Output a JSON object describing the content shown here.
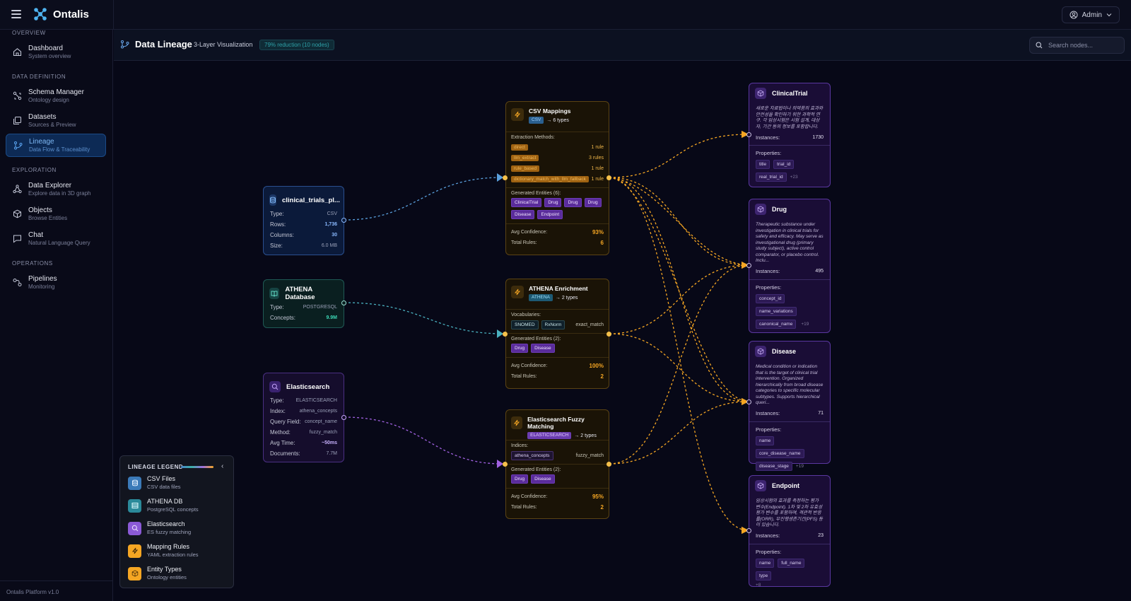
{
  "app": {
    "name": "Ontalis",
    "user_label": "Admin",
    "version": "Ontalis Platform v1.0"
  },
  "sidebar": {
    "sections": [
      {
        "title": "OVERVIEW",
        "items": [
          {
            "label": "Dashboard",
            "sub": "System overview",
            "icon": "home-icon"
          }
        ]
      },
      {
        "title": "DATA DEFINITION",
        "items": [
          {
            "label": "Schema Manager",
            "sub": "Ontology design",
            "icon": "schema-icon"
          },
          {
            "label": "Datasets",
            "sub": "Sources & Preview",
            "icon": "datasets-icon"
          },
          {
            "label": "Lineage",
            "sub": "Data Flow & Traceability",
            "icon": "lineage-icon",
            "active": true
          }
        ]
      },
      {
        "title": "EXPLORATION",
        "items": [
          {
            "label": "Data Explorer",
            "sub": "Explore data in 3D graph",
            "icon": "graph-icon"
          },
          {
            "label": "Objects",
            "sub": "Browse Entities",
            "icon": "cube-icon"
          },
          {
            "label": "Chat",
            "sub": "Natural Language Query",
            "icon": "chat-icon"
          }
        ]
      },
      {
        "title": "OPERATIONS",
        "items": [
          {
            "label": "Pipelines",
            "sub": "Monitoring",
            "icon": "pipeline-icon"
          }
        ]
      }
    ]
  },
  "page": {
    "title": "Data Lineage",
    "subtitle": "3-Layer Visualization",
    "badge": "79% reduction (10 nodes)",
    "search_placeholder": "Search nodes..."
  },
  "sources": {
    "csv": {
      "name": "clinical_trials_pl...",
      "rows": [
        {
          "k": "Type:",
          "v": "CSV"
        },
        {
          "k": "Rows:",
          "v": "1,736"
        },
        {
          "k": "Columns:",
          "v": "30"
        },
        {
          "k": "Size:",
          "v": "6.0 MB"
        }
      ]
    },
    "athena": {
      "name": "ATHENA Database",
      "rows": [
        {
          "k": "Type:",
          "v": "POSTGRESQL"
        },
        {
          "k": "Concepts:",
          "v": "9.9M"
        }
      ]
    },
    "es": {
      "name": "Elasticsearch",
      "rows": [
        {
          "k": "Type:",
          "v": "ELASTICSEARCH"
        },
        {
          "k": "Index:",
          "v": "athena_concepts"
        },
        {
          "k": "Query Field:",
          "v": "concept_name"
        },
        {
          "k": "Method:",
          "v": "fuzzy_match"
        },
        {
          "k": "Avg Time:",
          "v": "~50ms"
        },
        {
          "k": "Documents:",
          "v": "7.7M"
        }
      ]
    }
  },
  "mappings": {
    "csv": {
      "name": "CSV Mappings",
      "chip": "CSV",
      "types": "→ 6 types",
      "methods_label": "Extraction Methods:",
      "methods": [
        {
          "m": "direct",
          "c": "1 rule"
        },
        {
          "m": "llm_extract",
          "c": "3 rules"
        },
        {
          "m": "rule_based",
          "c": "1 rule"
        },
        {
          "m": "dictionary_match_with_llm_fallback",
          "c": "1 rule"
        }
      ],
      "entities_label": "Generated Entities (6):",
      "entities": [
        "ClinicalTrial",
        "Drug",
        "Drug",
        "Drug",
        "Disease",
        "Endpoint"
      ],
      "conf_label": "Avg Confidence:",
      "conf": "93%",
      "rules_label": "Total Rules:",
      "rules": "6"
    },
    "athena": {
      "name": "ATHENA Enrichment",
      "chip": "ATHENA",
      "types": "→ 2 types",
      "vocab_label": "Vocabularies:",
      "vocabs": [
        "SNOMED",
        "RxNorm"
      ],
      "method": "exact_match",
      "entities_label": "Generated Entities (2):",
      "entities": [
        "Drug",
        "Disease"
      ],
      "conf_label": "Avg Confidence:",
      "conf": "100%",
      "rules_label": "Total Rules:",
      "rules": "2"
    },
    "es": {
      "name": "Elasticsearch Fuzzy Matching",
      "chip": "ELASTICSEARCH",
      "types": "→ 2 types",
      "indices_label": "Indices:",
      "index": "athena_concepts",
      "method": "fuzzy_match",
      "entities_label": "Generated Entities (2):",
      "entities": [
        "Drug",
        "Disease"
      ],
      "conf_label": "Avg Confidence:",
      "conf": "95%",
      "rules_label": "Total Rules:",
      "rules": "2"
    }
  },
  "entities": {
    "clinicaltrial": {
      "name": "ClinicalTrial",
      "desc": "새로운 치료법이나 의약품의 효과와 안전성을 확인하기 위한 과학적 연구. 각 임상시험은 시험 설계, 대상자, 기간 등의 정보를 포함합니다.",
      "inst_label": "Instances:",
      "instances": "1730",
      "props_label": "Properties:",
      "props": [
        "title",
        "trial_id",
        "real_trial_id"
      ],
      "more": "+23"
    },
    "drug": {
      "name": "Drug",
      "desc": "Therapeutic substance under investigation in clinical trials for safety and efficacy. May serve as investigational drug (primary study subject), active control comparator, or placebo control. Inclu...",
      "inst_label": "Instances:",
      "instances": "495",
      "props_label": "Properties:",
      "props": [
        "concept_id",
        "name_variations",
        "canonical_name"
      ],
      "more": "+19"
    },
    "disease": {
      "name": "Disease",
      "desc": "Medical condition or indication that is the target of clinical trial intervention. Organized hierarchically from broad disease categories to specific molecular subtypes. Supports hierarchical queri...",
      "inst_label": "Instances:",
      "instances": "71",
      "props_label": "Properties:",
      "props": [
        "name",
        "core_disease_name",
        "disease_stage"
      ],
      "more": "+19"
    },
    "endpoint": {
      "name": "Endpoint",
      "desc": "임상시험의 효과를 측정하는 평가 변수(Endpoint). 1차 및 2차 유효성 평가 변수를 포함하며, 객관적 반응률(ORR), 무진행생존기간(PFS) 등이 있습니다.",
      "inst_label": "Instances:",
      "instances": "23",
      "props_label": "Properties:",
      "props": [
        "name",
        "full_name",
        "type"
      ],
      "more": "+8"
    }
  },
  "legend": {
    "title": "LINEAGE LEGEND",
    "items": [
      {
        "t1": "CSV Files",
        "t2": "CSV data files",
        "color": "#3b7ab8"
      },
      {
        "t1": "ATHENA DB",
        "t2": "PostgreSQL concepts",
        "color": "#2b8a9a"
      },
      {
        "t1": "Elasticsearch",
        "t2": "ES fuzzy matching",
        "color": "#8b5ad6"
      },
      {
        "t1": "Mapping Rules",
        "t2": "YAML extraction rules",
        "color": "#f5a623"
      },
      {
        "t1": "Entity Types",
        "t2": "Ontology entities",
        "color": "#f5a623"
      }
    ]
  },
  "colors": {
    "csv_edge": "#5aa0dd",
    "athena_edge": "#4ab0bf",
    "es_edge": "#a061e0",
    "entity_edge": "#f5a623"
  }
}
